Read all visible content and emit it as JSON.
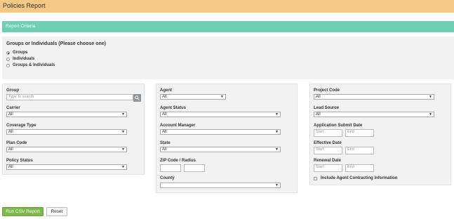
{
  "header": {
    "title": "Policies Report"
  },
  "criteria": {
    "label": "Report Criteria"
  },
  "groups_section": {
    "title": "Groups or Individuals (Please choose one)",
    "options": [
      {
        "label": "Groups",
        "selected": true
      },
      {
        "label": "Individuals",
        "selected": false
      },
      {
        "label": "Groups & Individuals",
        "selected": false
      }
    ]
  },
  "col1": {
    "group_label": "Group",
    "group_placeholder": "Type to search",
    "carrier_label": "Carrier",
    "carrier_value": "All",
    "coverage_label": "Coverage Type",
    "coverage_value": "All",
    "plan_label": "Plan Code",
    "plan_value": "All",
    "policy_status_label": "Policy Status",
    "policy_status_value": "All"
  },
  "col2": {
    "agent_label": "Agent",
    "agent_value": "All",
    "agent_status_label": "Agent Status",
    "agent_status_value": "All",
    "account_manager_label": "Account Manager",
    "account_manager_value": "All",
    "state_label": "State",
    "state_value": "All",
    "zip_label": "ZIP Code / Radius",
    "county_label": "County",
    "county_value": ""
  },
  "col3": {
    "project_code_label": "Project Code",
    "project_code_value": "All",
    "lead_source_label": "Lead Source",
    "lead_source_value": "All",
    "app_submit_label": "Application Submit Date",
    "effective_label": "Effective Date",
    "renewal_label": "Renewal Date",
    "start_placeholder": "Start",
    "end_placeholder": "End",
    "include_contracting_label": "Include Agent Contracting Information"
  },
  "actions": {
    "run_label": "Run CSV Report",
    "reset_label": "Reset"
  },
  "colors": {
    "header": "#f5c886",
    "criteria_bar": "#6fcfb2",
    "run_button": "#7fb84d"
  },
  "icons": {
    "search": "search-icon",
    "dropdown": "chevron-down-icon"
  }
}
